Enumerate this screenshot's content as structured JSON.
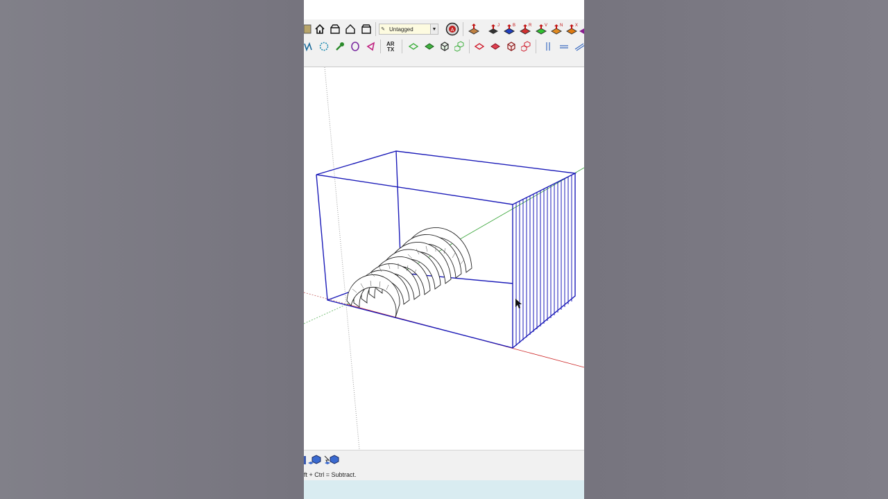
{
  "toolbar": {
    "tag_selector": {
      "value": "Untagged"
    }
  },
  "status": {
    "hint": "ft + Ctrl = Subtract."
  },
  "colors": {
    "selection_blue": "#1a1ab8",
    "axis_red": "#cc2222",
    "axis_green": "#3aa63a",
    "status_bar": "#d9ecf1"
  },
  "icons": {
    "row1": [
      "book-icon",
      "home-icon",
      "open-box-icon",
      "house-outline-icon",
      "box-icon",
      "pencil-icon",
      "chevron-down-icon",
      "shadow-globe-icon",
      "red-arrow-icon",
      "section-j-icon",
      "section-b-icon",
      "section-r-icon",
      "green-v-icon",
      "orange-n-icon",
      "orange-x-icon",
      "purple-icon"
    ],
    "row2": [
      "line-icon",
      "circle-dots-icon",
      "wrench-icon",
      "ellipse-icon",
      "freehand-icon",
      "artx-icon",
      "diamond-outline-icon",
      "diamond-green-icon",
      "cube-icon",
      "cubes-icon",
      "diamond-red-outline-icon",
      "diamond-red-icon",
      "cube-red-icon",
      "cubes-red-icon",
      "vertical-lines-icon",
      "horizontal-lines-icon",
      "diagonal-lines-icon"
    ]
  }
}
